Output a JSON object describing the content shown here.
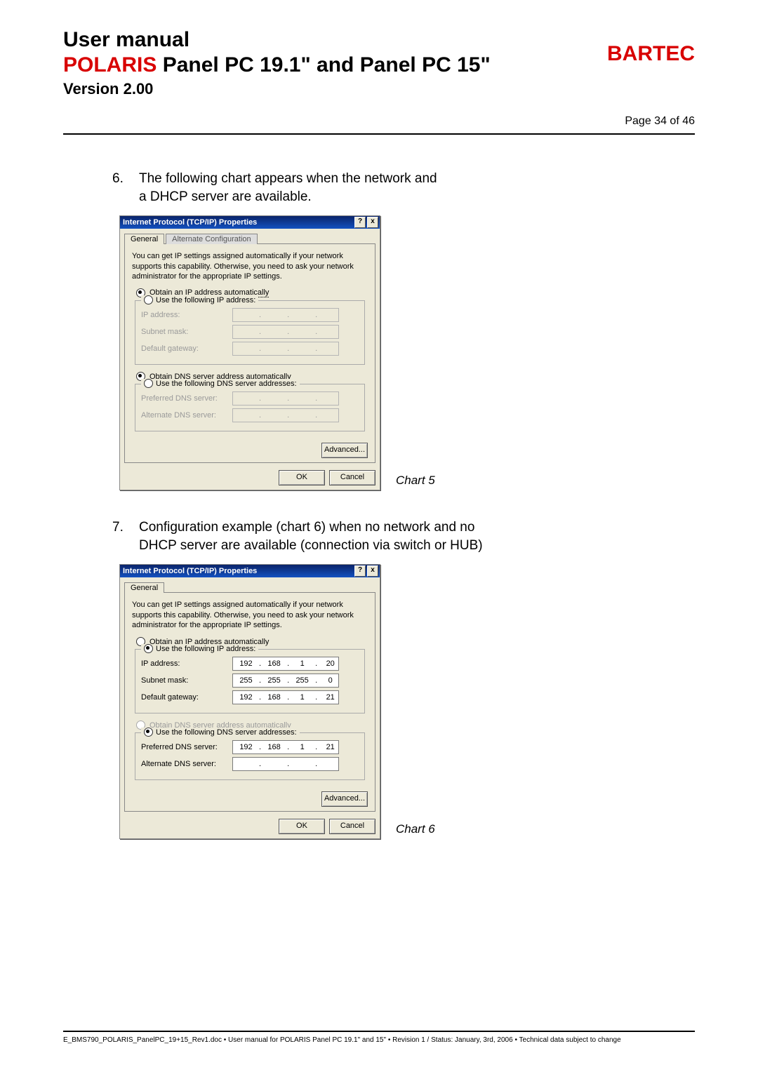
{
  "header": {
    "manual": "User manual",
    "polaris_red": "POLARIS",
    "polaris_rest": " Panel PC 19.1\" and Panel PC 15\"",
    "version": "Version 2.00",
    "brand": "BARTEC",
    "page": "Page 34 of 46"
  },
  "steps": {
    "s6_num": "6.",
    "s6_text1": "The following chart appears when the network and",
    "s6_text2": "a DHCP server are available.",
    "s7_num": "7.",
    "s7_text1": "Configuration example (chart 6) when no network and no",
    "s7_text2": "DHCP server are available (connection via switch or HUB)"
  },
  "chart5_label": "Chart 5",
  "chart6_label": "Chart 6",
  "dlg": {
    "title": "Internet Protocol (TCP/IP) Properties",
    "help": "?",
    "close": "x",
    "tab_general": "General",
    "tab_alt": "Alternate Configuration",
    "desc": "You can get IP settings assigned automatically if your network supports this capability. Otherwise, you need to ask your network administrator for the appropriate IP settings.",
    "r_auto_ip": "Obtain an IP address automatically",
    "r_use_ip": "Use the following IP address:",
    "lbl_ip": "IP address:",
    "lbl_mask": "Subnet mask:",
    "lbl_gw": "Default gateway:",
    "r_auto_dns": "Obtain DNS server address automatically",
    "r_use_dns": "Use the following DNS server addresses:",
    "lbl_pdns": "Preferred DNS server:",
    "lbl_adns": "Alternate DNS server:",
    "btn_adv": "Advanced...",
    "btn_ok": "OK",
    "btn_cancel": "Cancel"
  },
  "chart6_vals": {
    "ip": [
      "192",
      "168",
      "1",
      "20"
    ],
    "mask": [
      "255",
      "255",
      "255",
      "0"
    ],
    "gw": [
      "192",
      "168",
      "1",
      "21"
    ],
    "pdns": [
      "192",
      "168",
      "1",
      "21"
    ],
    "adns": [
      "",
      "",
      "",
      ""
    ]
  },
  "footer": "E_BMS790_POLARIS_PanelPC_19+15_Rev1.doc   •   User manual for POLARIS Panel PC 19.1\" and 15\"   •   Revision 1 / Status: January, 3rd, 2006   •   Technical data subject to change"
}
